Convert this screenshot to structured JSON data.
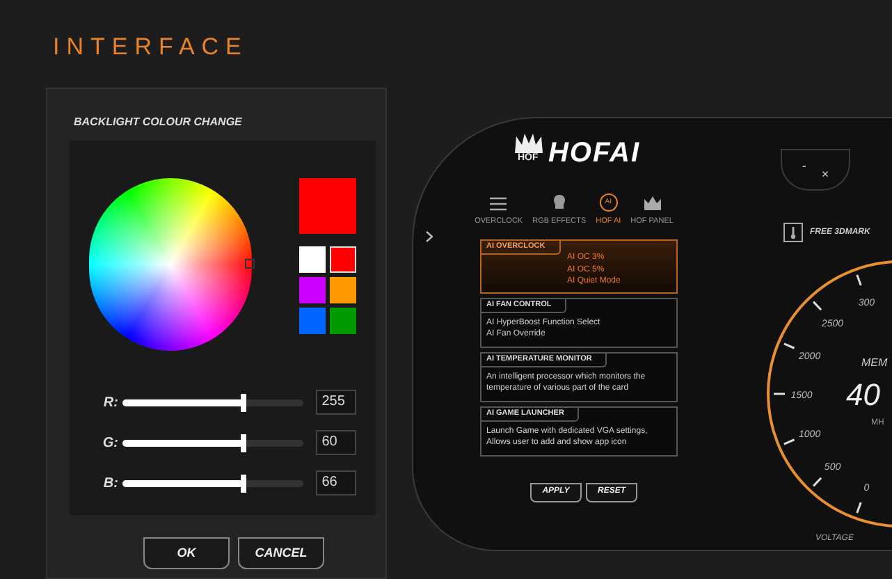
{
  "heading": "INTERFACE",
  "dialog": {
    "title": "BACKLIGHT COLOUR CHANGE",
    "preview": {
      "color": "#ff0000"
    },
    "swatches": [
      {
        "color": "#ffffff",
        "selected": false
      },
      {
        "color": "#ff0000",
        "selected": true
      },
      {
        "color": "#cc00ff",
        "selected": false
      },
      {
        "color": "#ff9900",
        "selected": false
      },
      {
        "color": "#0066ff",
        "selected": false
      },
      {
        "color": "#009900",
        "selected": false
      }
    ],
    "sliders": [
      {
        "label": "R:",
        "level": 0.67,
        "value": "255"
      },
      {
        "label": "G:",
        "level": 0.67,
        "value": "60"
      },
      {
        "label": "B:",
        "level": 0.67,
        "value": "66"
      }
    ],
    "buttons": [
      "OK",
      "CANCEL"
    ]
  },
  "app": {
    "logo": {
      "crown_text": "HOF",
      "text": "HOFAI"
    },
    "tabs": [
      {
        "kind": "menu",
        "label": "OVERCLOCK",
        "selected": false
      },
      {
        "kind": "bulb",
        "label": "RGB EFFECTS",
        "selected": false
      },
      {
        "kind": "ai",
        "badge": "AI",
        "label": "HOF AI",
        "selected": true
      },
      {
        "kind": "crown",
        "label": "HOF PANEL",
        "selected": false
      }
    ],
    "cards": [
      {
        "title": "AI OVERCLOCK",
        "selected": true,
        "lines": [
          "AI OC 3%",
          "AI OC 5%",
          "AI Quiet Mode"
        ]
      },
      {
        "title": "AI FAN CONTROL",
        "selected": false,
        "lines": [
          "AI HyperBoost Function Select",
          "AI Fan Override"
        ]
      },
      {
        "title": "AI TEMPERATURE MONITOR",
        "selected": false,
        "lines": [
          "An intelligent processor which monitors the temperature of various part of the card"
        ]
      },
      {
        "title": "AI GAME LAUNCHER",
        "selected": false,
        "lines": [
          "Launch Game with dedicated VGA settings, Allows user to add and show app icon"
        ]
      }
    ],
    "buttons": [
      "APPLY",
      "RESET"
    ],
    "window_controls": [
      "-",
      "×"
    ],
    "gauge": {
      "header": "FREE 3DMARK",
      "title": "MEM",
      "reading": "40",
      "unit": "MH",
      "footer": "VOLTAGE",
      "ticks": [
        "0",
        "500",
        "1000",
        "1500",
        "2000",
        "2500",
        "300"
      ]
    }
  }
}
